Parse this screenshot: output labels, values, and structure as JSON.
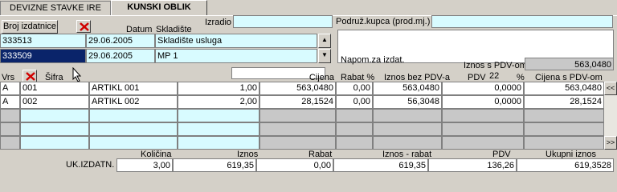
{
  "tabs": [
    {
      "label": "DEVIZNE STAVKE IRE"
    },
    {
      "label": "KUNSKI OBLIK"
    }
  ],
  "header": {
    "broj_izdatnice_btn": "Broj izdatnice",
    "datum_label": "Datum",
    "skladiste_label": "Skladište",
    "izradio_label": "Izradio",
    "izradio_value": "",
    "podruz_label": "Podruž.kupca (prod.mj.)",
    "podruz_value": "",
    "napom_label": "Napom.za izdat.",
    "napom_value": "",
    "iznos_pdv_label": "Iznos s PDV-om",
    "iznos_pdv_value": "563,0480",
    "docs": [
      {
        "broj": "333513",
        "datum": "29.06.2005",
        "skladiste": "Skladište usluga"
      },
      {
        "broj": "333509",
        "datum": "29.06.2005",
        "skladiste": "MP 1"
      }
    ]
  },
  "grid": {
    "headers": {
      "vrs": "Vrs",
      "sifra": "Šifra",
      "cijena": "Cijena",
      "rabat": "Rabat %",
      "iznos_bez": "Iznos bez PDV-a",
      "pdv": "PDV",
      "pdv_rate": "22",
      "pct": "%",
      "cijena_pdv": "Cijena s PDV-om"
    },
    "search_value": "",
    "rows": [
      {
        "vrs": "A",
        "sifra": "001",
        "naziv": "ARTIKL 001",
        "kolicina": "1,00",
        "cijena": "563,0480",
        "rabat": "0,00",
        "iznos_bez": "563,0480",
        "pdv": "0,0000",
        "cijena_pdv": "563,0480"
      },
      {
        "vrs": "A",
        "sifra": "002",
        "naziv": "ARTIKL 002",
        "kolicina": "2,00",
        "cijena": "28,1524",
        "rabat": "0,00",
        "iznos_bez": "56,3048",
        "pdv": "0,0000",
        "cijena_pdv": "28,1524"
      }
    ],
    "scroll_up": "<<",
    "scroll_down": ">>"
  },
  "footer": {
    "kolicina_label": "Količina",
    "iznos_label": "Iznos",
    "rabat_label": "Rabat",
    "iznos_rabat_label": "Iznos - rabat",
    "pdv_label": "PDV",
    "ukupni_label": "Ukupni iznos",
    "row_label": "UK.IZDATN.",
    "kolicina": "3,00",
    "iznos": "619,35",
    "rabat": "0,00",
    "iznos_rabat": "619,35",
    "pdv": "136,26",
    "ukupni": "619,3528"
  }
}
